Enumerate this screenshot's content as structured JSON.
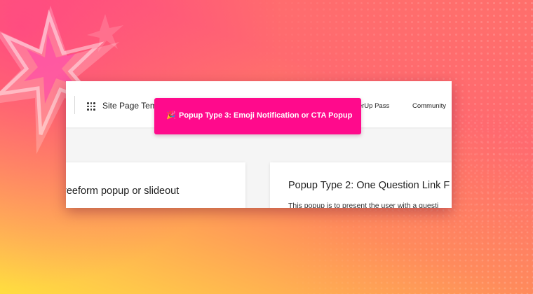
{
  "topbar": {
    "site_title": "Site Page Tem",
    "nav": [
      {
        "label": "werUp Pass"
      },
      {
        "label": "Community"
      }
    ]
  },
  "banner": {
    "icon": "party-popper-icon",
    "icon_glyph": "🎉",
    "text": "Popup Type 3: Emoji Notification or CTA Popup",
    "background": "#ff0a8c"
  },
  "cards": [
    {
      "title": "reeform popup or slideout"
    },
    {
      "title": "Popup Type 2: One Question Link F",
      "body": "This popup is to present the user with a questi"
    }
  ],
  "colors": {
    "banner_bg": "#ff0a8c",
    "background_top": "#ff6a6f",
    "background_bottom": "#ffdd3f"
  }
}
